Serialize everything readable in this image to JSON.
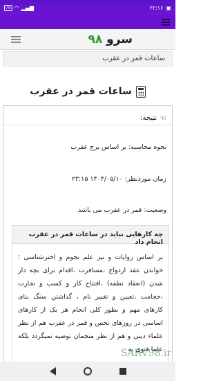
{
  "status_bar": {
    "time": "۲۲:۱۶",
    "battery_badge": "79"
  },
  "header": {
    "brand_text": "سرو",
    "brand_number": "۹۸"
  },
  "breadcrumb": "ساعات قمر در عقرب",
  "page_title": "ساعات قمر در عقرب",
  "result": {
    "header_label": "نتیجه:",
    "method_line": "نحوه محاسبه: بر اساس برج عقرب",
    "time_line": "زمان موردنظر: ۱۴۰۴/۰۵/۱۰ ۲۳:۱۵",
    "status_line": "وضعیت: قمر در عقرب می باشد"
  },
  "advice": {
    "title": "چه کارهایی نباید در ساعات قمر در عقرب انجام داد",
    "body": "بر اساس روایات و نیز علم نجوم و اخترشناسی ؛ خواندن عقد ازدواج ،مسافرت ،اقدام برای بچه دار شدن (انعقاد نطفه) ،افتتاح کار و کسب و تجارت ،حجامت ،تعیین و تغییر نام ، گذاشتن سنگ بنای کارهای مهم و بطور کلی انجام هر یک از کارهای اساسی در روزهای نحس و قمر در عقرب هم از نظر علماء دینی و هم از نظر منجمان توصیه نمیگردد بلکه علما فتوی به"
  },
  "watermark": "SARV98.ir",
  "colors": {
    "status_purple": "#6a12cf",
    "brand_green": "#2e9b2e"
  }
}
